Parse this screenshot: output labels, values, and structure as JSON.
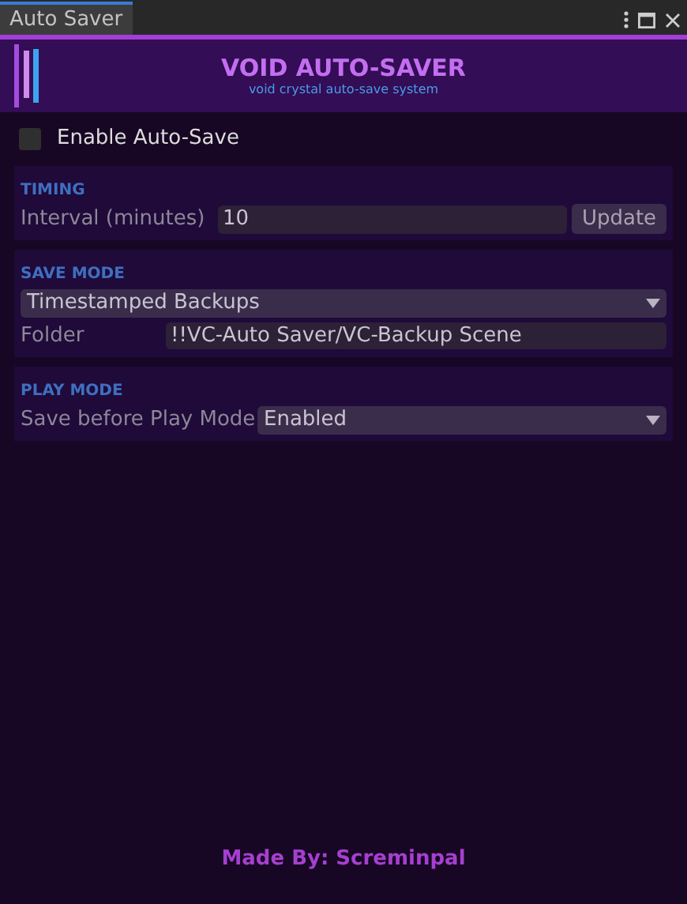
{
  "window": {
    "tab": "Auto Saver"
  },
  "header": {
    "title": "VOID AUTO-SAVER",
    "subtitle": "void crystal auto-save system"
  },
  "enable": {
    "label": "Enable Auto-Save",
    "checked": false
  },
  "sections": [
    {
      "title": "TIMING",
      "rows": [
        {
          "kind": "number",
          "label": "Interval (minutes)",
          "value": "10",
          "button": "Update"
        }
      ]
    },
    {
      "title": "SAVE MODE",
      "rows": [
        {
          "kind": "dropdown",
          "value": "Timestamped Backups"
        },
        {
          "kind": "text",
          "label": "Folder",
          "value": "!!VC-Auto Saver/VC-Backup Scene"
        }
      ]
    },
    {
      "title": "PLAY MODE",
      "rows": [
        {
          "kind": "dropdown",
          "label": "Save before Play Mode",
          "value": "Enabled"
        }
      ]
    }
  ],
  "footer": "Made By: Screminpal"
}
